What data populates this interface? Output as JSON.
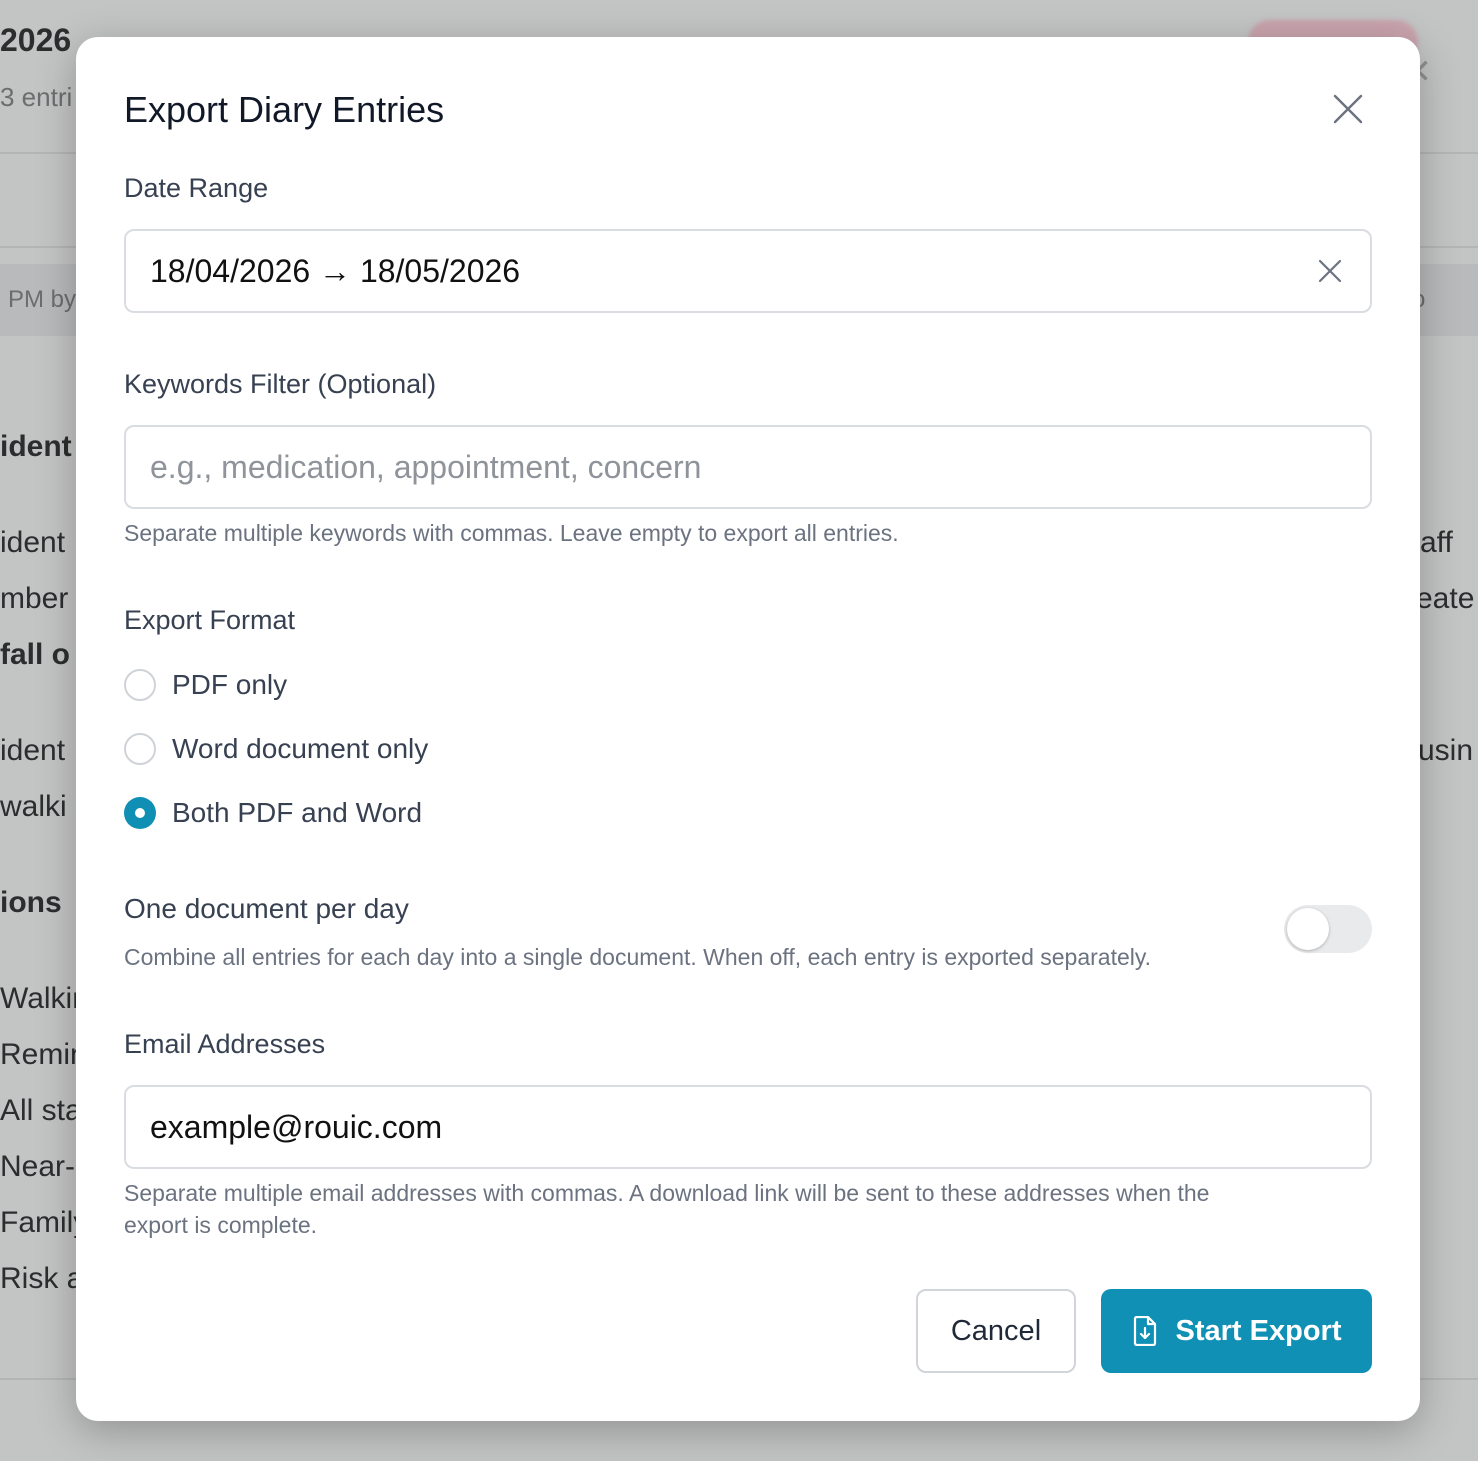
{
  "background": {
    "heading": "2026",
    "subheading": "3 entri",
    "band_text": "PM by",
    "band_right": "o",
    "lines_left": [
      {
        "text": "ident",
        "bold": true
      },
      {
        "text": "ident",
        "bold": false
      },
      {
        "text": "mber",
        "bold": false
      },
      {
        "text": "fall o",
        "bold": true
      },
      {
        "text": "ident",
        "bold": false
      },
      {
        "text": " walki",
        "bold": false
      },
      {
        "text": "ions",
        "bold": true
      },
      {
        "text": "Walkin",
        "bold": false
      },
      {
        "text": "Remin",
        "bold": false
      },
      {
        "text": "All sta",
        "bold": false
      },
      {
        "text": "Near-",
        "bold": false
      },
      {
        "text": "Family",
        "bold": false
      },
      {
        "text": "Risk a",
        "bold": false
      }
    ],
    "lines_right": [
      "aff",
      "eate",
      "usin"
    ]
  },
  "modal": {
    "title": "Export Diary Entries",
    "date_range": {
      "label": "Date Range",
      "value": "18/04/2026 → 18/05/2026"
    },
    "keywords": {
      "label": "Keywords Filter (Optional)",
      "placeholder": "e.g., medication, appointment, concern",
      "value": "",
      "help": "Separate multiple keywords with commas. Leave empty to export all entries."
    },
    "export_format": {
      "label": "Export Format",
      "options": [
        {
          "label": "PDF only",
          "checked": false
        },
        {
          "label": "Word document only",
          "checked": false
        },
        {
          "label": "Both PDF and Word",
          "checked": true
        }
      ]
    },
    "per_day": {
      "title": "One document per day",
      "help": "Combine all entries for each day into a single document. When off, each entry is exported separately.",
      "enabled": false
    },
    "emails": {
      "label": "Email Addresses",
      "value": "example@rouic.com",
      "help_line1": "Separate multiple email addresses with commas. A download link will be sent to these addresses when the",
      "help_line2": "export is complete."
    },
    "buttons": {
      "cancel": "Cancel",
      "start": "Start Export"
    },
    "colors": {
      "accent": "#1190b5"
    }
  }
}
